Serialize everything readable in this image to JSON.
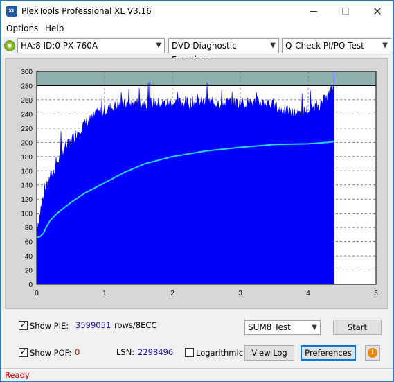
{
  "window": {
    "title": "PlexTools Professional XL V3.16",
    "icon_text": "XL"
  },
  "menu": [
    {
      "label": "Options"
    },
    {
      "label": "Help"
    }
  ],
  "toolbar": {
    "drive": "HA:8 ID:0  PX-760A",
    "function": "DVD Diagnostic Functions",
    "test": "Q-Check PI/PO Test"
  },
  "chart_data": {
    "type": "area",
    "title": "",
    "xlabel": "",
    "ylabel": "",
    "xlim": [
      0,
      5
    ],
    "ylim": [
      0,
      300
    ],
    "x_ticks": [
      0,
      1,
      2,
      3,
      4,
      5
    ],
    "y_ticks": [
      0,
      20,
      40,
      60,
      80,
      100,
      120,
      140,
      160,
      180,
      200,
      220,
      240,
      260,
      280,
      300
    ],
    "threshold_line": 280,
    "grid": true,
    "series": [
      {
        "color": "#0000ff",
        "x": [
          0.0,
          0.05,
          0.1,
          0.2,
          0.3,
          0.4,
          0.5,
          0.6,
          0.7,
          0.8,
          0.9,
          1.0,
          1.2,
          1.5,
          2.0,
          2.5,
          3.0,
          3.4,
          3.6,
          3.8,
          4.0,
          4.2,
          4.3,
          4.38
        ],
        "y": [
          80,
          100,
          125,
          150,
          170,
          190,
          200,
          215,
          225,
          232,
          240,
          245,
          252,
          255,
          255,
          256,
          255,
          256,
          245,
          240,
          245,
          255,
          265,
          280
        ]
      },
      {
        "color": "#2ad4e8",
        "x": [
          0.0,
          0.05,
          0.1,
          0.15,
          0.2,
          0.3,
          0.5,
          0.7,
          1.0,
          1.3,
          1.6,
          2.0,
          2.5,
          3.0,
          3.5,
          4.0,
          4.3,
          4.38
        ],
        "y": [
          66,
          67,
          72,
          82,
          90,
          100,
          115,
          128,
          143,
          158,
          170,
          180,
          188,
          193,
          197,
          198,
          200,
          201
        ]
      }
    ]
  },
  "bottom": {
    "show_pie_label": "Show PIE:",
    "pie_value": "3599051",
    "pie_unit": "rows/8ECC",
    "show_pof_label": "Show POF:",
    "pof_value": "0",
    "lsn_label": "LSN:",
    "lsn_value": "2298496",
    "logarithmic_label": "Logarithmic",
    "sum_select": "SUM8 Test",
    "start_label": "Start",
    "view_log_label": "View Log",
    "preferences_label": "Preferences"
  },
  "status": {
    "text": "Ready"
  }
}
